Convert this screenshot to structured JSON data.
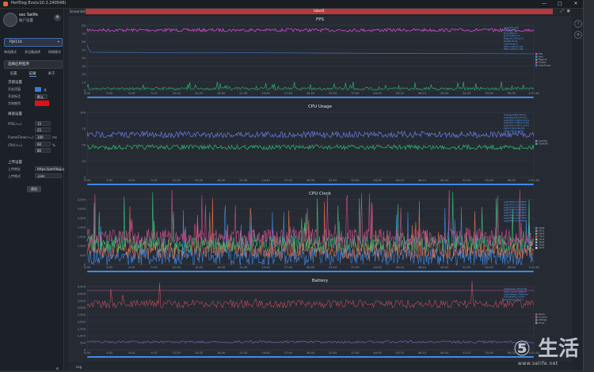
{
  "window": {
    "title": "PerfDog Evo(v10.2.240548)"
  },
  "sidebar": {
    "user_name": "sec Selife",
    "user_account": "账户设置",
    "device_label": "PJX110",
    "device_links": [
      "单选模式",
      "多设备选择",
      "网络模式"
    ],
    "app_label": "选择应用程序",
    "tabs": [
      "设置",
      "记录",
      "关于"
    ],
    "active_tab": "记录",
    "float_section": "浮窗设置",
    "float_rows": [
      "开启浮窗",
      "开启标注",
      "字体颜色"
    ],
    "float_toggle_text": "关",
    "float_select": "默认",
    "threshold_section": "阈值设置",
    "threshold_rows": [
      {
        "label": "FPS(>=)",
        "value": "15"
      },
      {
        "label": "",
        "value": "25"
      },
      {
        "label": "FrameTime(>=)",
        "value": "100",
        "unit": "ms"
      },
      {
        "label": "CPU(>=)",
        "value": "60",
        "unit": "%"
      },
      {
        "label": "",
        "value": "80",
        "unit": ""
      }
    ],
    "upload_section": "上传设置",
    "upload_rows": [
      {
        "label": "上传地址",
        "value": "https://perfdog.q"
      },
      {
        "label": "上传格式",
        "value": ".json"
      }
    ],
    "logout": "退出"
  },
  "toolbar": {
    "left": "Screenlist",
    "tab": "label1"
  },
  "charts": [
    {
      "title": "FPS",
      "yticks": [
        "80",
        "70",
        "60",
        "50",
        "40",
        "30",
        "20",
        "10",
        "0"
      ],
      "legend_top": [
        "Avg(FPS):120",
        "Var(FPS):0.8",
        "Drop(FPS):0",
        "Jank(/10min):0",
        "BigJank(/10min):0",
        "Stutter(%):0",
        "InterFrame:0",
        "FPS>=18(%):100",
        "FPS>=25(%):100"
      ],
      "legend_side": [
        "FPS",
        "Jank",
        "BigJank",
        "Stutter",
        "InterFrame"
      ],
      "colors": [
        "#d04bd0",
        "#4c7cd8",
        "#2fbf6f"
      ]
    },
    {
      "title": "CPU Usage",
      "yticks": [
        "100",
        "75",
        "50",
        "25",
        "0"
      ],
      "legend_top": [
        "Avg(AppCPU):28.1%",
        "Avg(TotalCPU):49.6%",
        "Avg(CPU>=60%):0.0%",
        "Avg(CPU>=80%):0.0%",
        "Avg(CPU>=90%):0.0%",
        "CPU<=50%:60.8%",
        "CPU<=80%:100%"
      ],
      "legend_side": [
        "AppCPU",
        "TotalCPU"
      ],
      "colors": [
        "#6f7be8",
        "#2fbf6f"
      ]
    },
    {
      "title": "CPU Clock",
      "yticks": [
        "3,500",
        "3,000",
        "2,500",
        "2,000",
        "1,500",
        "1,000",
        "500",
        "0"
      ],
      "legend_top": [
        "Avg(CPU0):1113MHz",
        "Avg(CPU1):1113MHz",
        "Avg(CPU2):1113MHz",
        "Avg(CPU3):1622MHz",
        "Avg(CPU4):1622MHz",
        "Avg(CPU5):1622MHz",
        "Avg(CPU6):1887MHz",
        "Avg(CPU7):2147MHz"
      ],
      "legend_side": [
        "CPU0",
        "CPU1",
        "CPU2",
        "CPU3",
        "CPU4",
        "CPU5",
        "CPU6",
        "CPU7"
      ],
      "colors": [
        "#3f8be6",
        "#e0704a",
        "#3fbf7f",
        "#c7508a",
        "#e5c04a",
        "#5dc6d6",
        "#9a6ae0",
        "#d9d9d9"
      ]
    },
    {
      "title": "Battery",
      "yticks": [
        "4,500",
        "4,000",
        "3,500",
        "3,000",
        "2,500",
        "2,000",
        "1,500",
        "1,000",
        "500",
        "0"
      ],
      "legend_top": [
        "Avg(Power):3512mW",
        "Avg(Current):880mA",
        "Avg(Voltage):3992mV",
        "Sum(Battery):2.5%",
        "Avg(Temp):36.2°C"
      ],
      "legend_side": [
        "Power",
        "Current",
        "Voltage",
        "Temp"
      ],
      "colors": [
        "#c0505a",
        "#8a66c8",
        "#d05ab0",
        "#3fbf7f"
      ]
    }
  ],
  "xticks": [
    "0:00",
    "3:05",
    "6:10",
    "9:15",
    "12:20",
    "15:25",
    "18:30",
    "21:35",
    "24:40",
    "27:45",
    "30:50",
    "33:55",
    "37:00",
    "40:05",
    "43:10",
    "46:15",
    "49:20",
    "52:25",
    "55:30",
    "58:35",
    "1:01:40"
  ],
  "bottom_label": "Log",
  "watermark": {
    "logo": "⑤ 生活",
    "url": "www.selife.net"
  }
}
